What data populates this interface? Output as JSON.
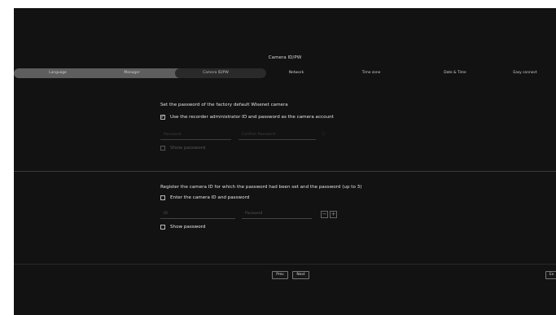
{
  "page_title": "Camera ID/PW",
  "steps": [
    "Language",
    "Manager",
    "Camera ID/PW",
    "Network",
    "Time zone",
    "Date & Time",
    "Easy connect"
  ],
  "section1": {
    "title": "Set the password of the factory default Wisenet camera",
    "use_recorder_label": "Use the recorder administrator ID and password as the camera account",
    "use_recorder_checked": "✓",
    "password_placeholder": "Password",
    "confirm_placeholder": "Confirm Password",
    "show_password_label": "Show password"
  },
  "section2": {
    "title": "Register the camera ID for which the password had been set and the password (up to 3)",
    "enter_label": "Enter the camera ID and password",
    "id_placeholder": "ID",
    "password_placeholder": "Password",
    "minus": "−",
    "plus": "+",
    "show_password_label": "Show password"
  },
  "buttons": {
    "prev": "Prev",
    "next": "Next",
    "cut_off": "Ex"
  }
}
